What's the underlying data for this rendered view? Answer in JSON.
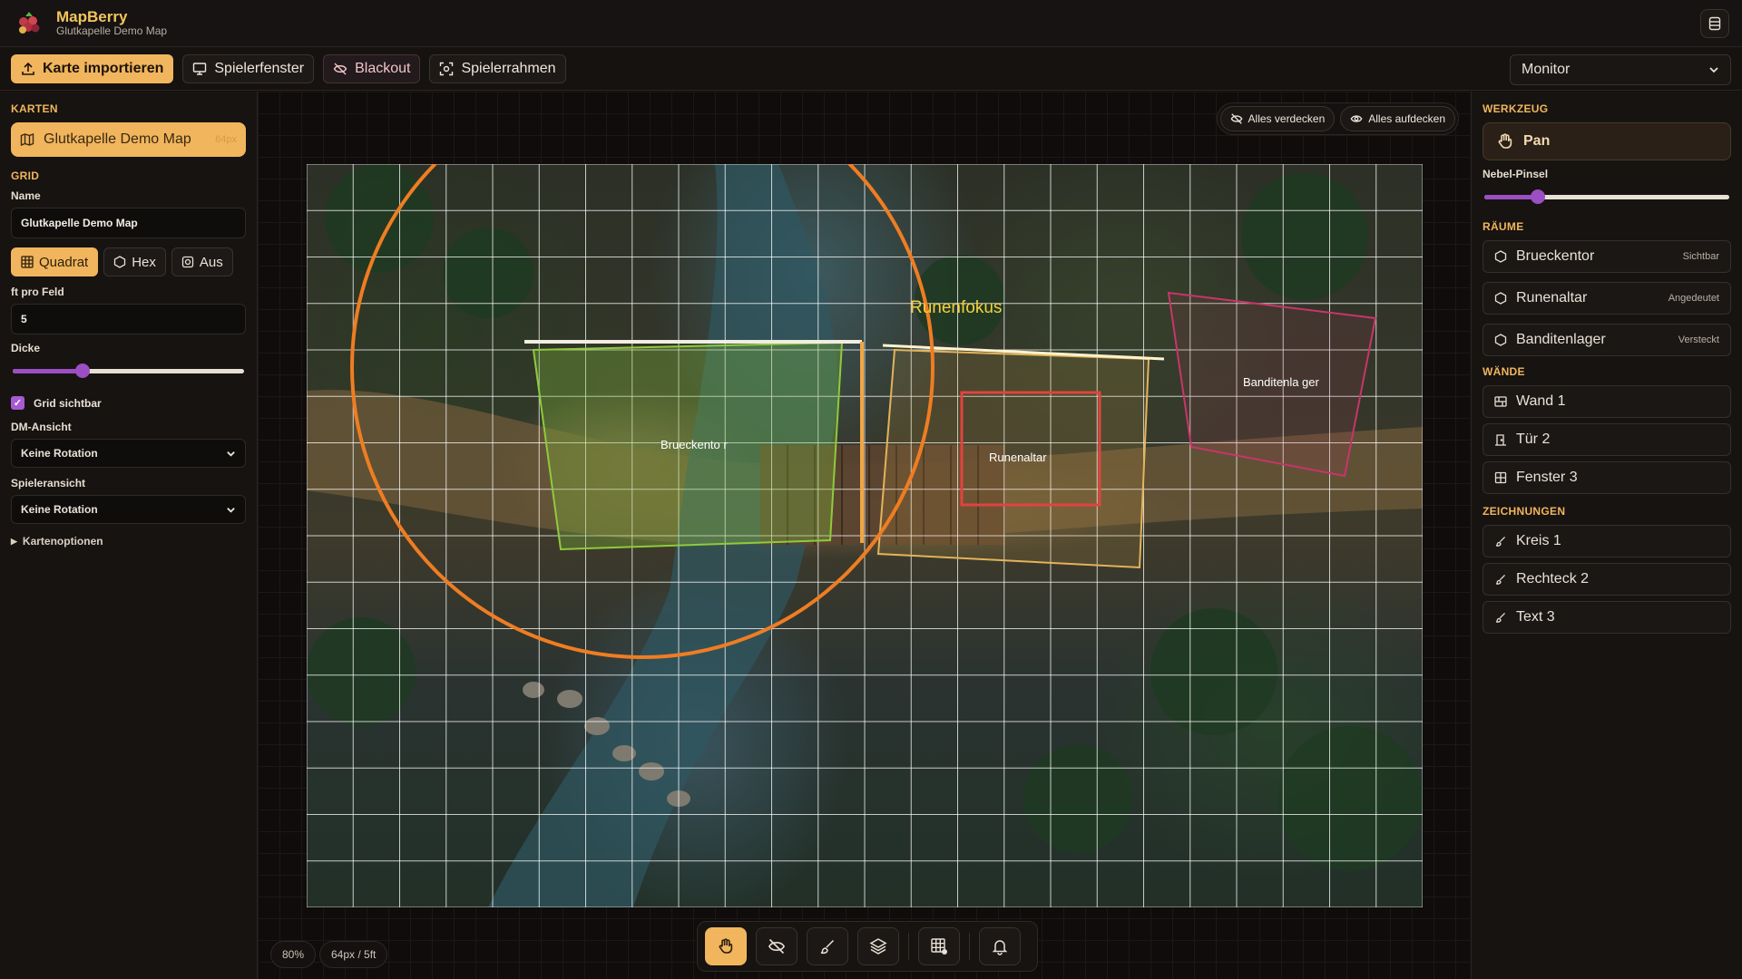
{
  "app": {
    "title": "MapBerry",
    "subtitle": "Glutkapelle Demo Map"
  },
  "toolbar": {
    "import": "Karte importieren",
    "player_window": "Spielerfenster",
    "blackout": "Blackout",
    "player_frame": "Spielerrahmen",
    "monitor": "Monitor"
  },
  "left": {
    "maps_title": "KARTEN",
    "map_name": "Glutkapelle Demo Map",
    "map_size": "64px",
    "grid_title": "GRID",
    "name_label": "Name",
    "name_value": "Glutkapelle Demo Map",
    "grid_types": [
      "Quadrat",
      "Hex",
      "Aus"
    ],
    "feet_label": "ft pro Feld",
    "feet_value": "5",
    "thickness_label": "Dicke",
    "thickness_value": 0.3,
    "grid_visible": "Grid sichtbar",
    "dm_view_label": "DM-Ansicht",
    "dm_view_value": "Keine Rotation",
    "player_view_label": "Spieleransicht",
    "player_view_value": "Keine Rotation",
    "map_options": "Kartenoptionen"
  },
  "canvas": {
    "hide_all": "Alles verdecken",
    "reveal_all": "Alles aufdecken",
    "zoom": "80%",
    "scale": "64px / 5ft",
    "labels": {
      "runenfokus": "Runenfokus",
      "brueckentor": "Brueckento r",
      "runenaltar": "Runenaltar",
      "banditenlager": "Banditenla ger"
    }
  },
  "right": {
    "tool_title": "WERKZEUG",
    "tool_pan": "Pan",
    "brush_label": "Nebel-Pinsel",
    "brush_value": 0.22,
    "rooms_title": "RÄUME",
    "rooms": [
      {
        "name": "Brueckentor",
        "status": "Sichtbar"
      },
      {
        "name": "Runenaltar",
        "status": "Angedeutet"
      },
      {
        "name": "Banditenlager",
        "status": "Versteckt"
      }
    ],
    "walls_title": "WÄNDE",
    "walls": [
      "Wand 1",
      "Tür 2",
      "Fenster 3"
    ],
    "drawings_title": "ZEICHNUNGEN",
    "drawings": [
      "Kreis 1",
      "Rechteck 2",
      "Text 3"
    ]
  },
  "colors": {
    "accent": "#f1b55d",
    "slider": "#9b4fc2",
    "circle": "#ef7d22"
  },
  "icons": [
    "upload-icon",
    "monitor-icon",
    "eye-off-icon",
    "frame-icon",
    "database-icon",
    "map-icon",
    "grid-icon",
    "hexagon-icon",
    "off-icon",
    "hand-icon",
    "brush-icon",
    "layers-icon",
    "bell-icon",
    "wall-icon",
    "door-icon",
    "window-icon"
  ]
}
